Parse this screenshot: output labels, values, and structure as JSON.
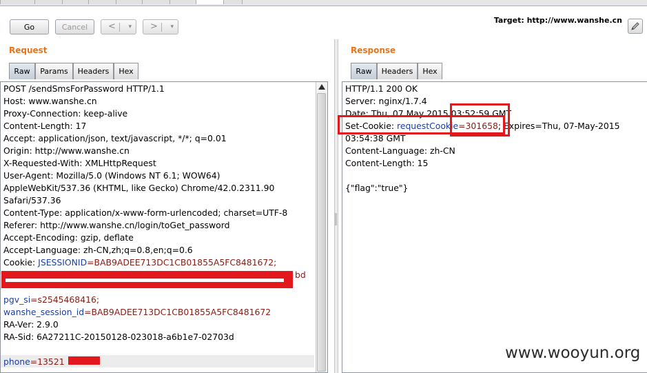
{
  "toolbar": {
    "go_label": "Go",
    "cancel_label": "Cancel",
    "back_glyph": "<",
    "forward_glyph": ">",
    "dropdown_glyph": "▾",
    "target_label": "Target: http://www.wanshe.cn",
    "edit_icon": "pencil-icon"
  },
  "request": {
    "title": "Request",
    "tabs": [
      "Raw",
      "Params",
      "Headers",
      "Hex"
    ],
    "active_tab": "Raw",
    "lines": {
      "l1": "POST /sendSmsForPassword HTTP/1.1",
      "l2": "Host: www.wanshe.cn",
      "l3": "Proxy-Connection: keep-alive",
      "l4": "Content-Length: 17",
      "l5": "Accept: application/json, text/javascript, */*; q=0.01",
      "l6": "Origin: http://www.wanshe.cn",
      "l7": "X-Requested-With: XMLHttpRequest",
      "l8": "User-Agent: Mozilla/5.0 (Windows NT 6.1; WOW64)",
      "l9": "AppleWebKit/537.36 (KHTML, like Gecko) Chrome/42.0.2311.90",
      "l10": "Safari/537.36",
      "l11": "Content-Type: application/x-www-form-urlencoded; charset=UTF-8",
      "l12": "Referer: http://www.wanshe.cn/login/toGet_password",
      "l13": "Accept-Encoding: gzip, deflate",
      "l14": "Accept-Language: zh-CN,zh;q=0.8,en;q=0.6",
      "cookie_label": "Cookie: ",
      "cookie_key": "JSESSIONID",
      "cookie_val": "=BAB9ADEE713DC1CB01855A5FC8481672;",
      "redacted_tail": "bd",
      "pgv_si_key": "pgv_si",
      "pgv_si_val": "=s2545468416;",
      "wsid_key": "wanshe_session_id",
      "wsid_val": "=BAB9ADEE713DC1CB01855A5FC8481672",
      "l19": "RA-Ver: 2.9.0",
      "l20": "RA-Sid: 6A27211C-20150128-023018-a6b1e7-02703d",
      "phone_key": "phone",
      "phone_val": "=13521"
    }
  },
  "response": {
    "title": "Response",
    "tabs": [
      "Raw",
      "Headers",
      "Hex"
    ],
    "active_tab": "Raw",
    "lines": {
      "r1": "HTTP/1.1 200 OK",
      "r2": "Server: nginx/1.7.4",
      "r3": "Date: Thu, 07 May 2015 03:52:59 GMT",
      "setcookie_label": "Set-Cookie: ",
      "setcookie_key": "requestCookie",
      "setcookie_val": "=301658",
      "setcookie_rest": "; Expires=Thu, 07-May-2015",
      "r5": "03:54:38 GMT",
      "r6": "Content-Language: zh-CN",
      "r7": "Content-Length: 15",
      "r9": "{\"flag\":\"true\"}"
    }
  },
  "watermark": "www.wooyun.org",
  "colors": {
    "section_title": "#e8741a",
    "param_key": "#1d3e9e",
    "param_value": "#8b1a12",
    "highlight_box": "#e3181c"
  }
}
